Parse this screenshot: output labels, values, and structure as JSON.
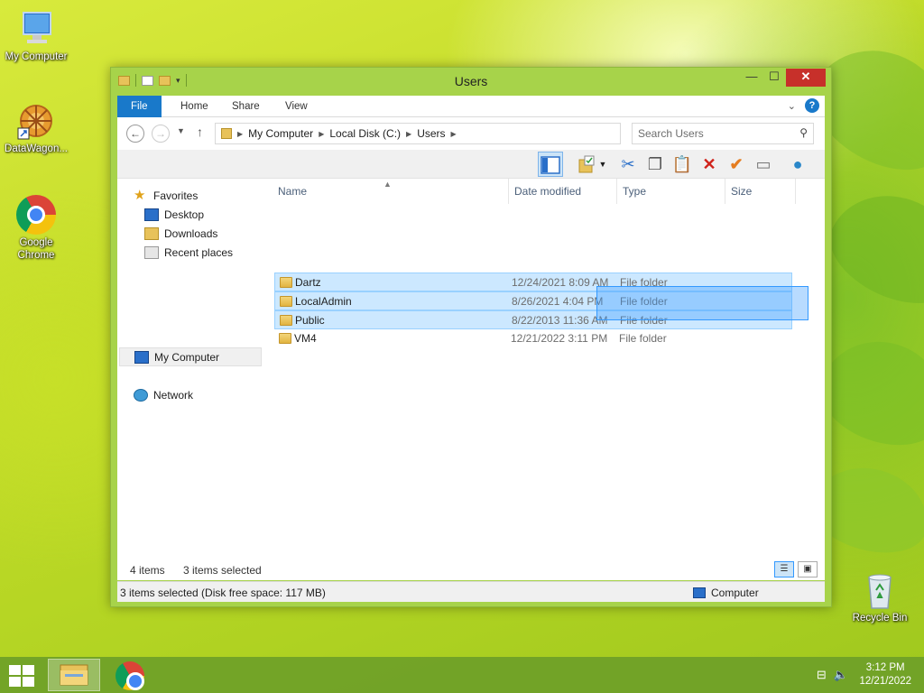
{
  "desktop": {
    "icons": [
      {
        "label": "My Computer"
      },
      {
        "label": "DataWagon..."
      },
      {
        "label": "Google Chrome"
      },
      {
        "label": "Recycle Bin"
      }
    ]
  },
  "window": {
    "title": "Users",
    "controls": {
      "minimize": "—",
      "maximize": "☐",
      "close": "✕"
    }
  },
  "ribbon": {
    "tabs": [
      "File",
      "Home",
      "Share",
      "View"
    ],
    "expand_icon": "⌄",
    "help": "?"
  },
  "address": {
    "breadcrumbs": [
      "My Computer",
      "Local Disk (C:)",
      "Users"
    ],
    "search_placeholder": "Search Users"
  },
  "navpane": {
    "favorites": "Favorites",
    "desktop": "Desktop",
    "downloads": "Downloads",
    "recent": "Recent places",
    "mycomputer": "My Computer",
    "network": "Network"
  },
  "columns": {
    "name": "Name",
    "date": "Date modified",
    "type": "Type",
    "size": "Size"
  },
  "files": [
    {
      "name": "Dartz",
      "date": "12/24/2021 8:09 AM",
      "type": "File folder",
      "size": "",
      "selected": true
    },
    {
      "name": "LocalAdmin",
      "date": "8/26/2021 4:04 PM",
      "type": "File folder",
      "size": "",
      "selected": true
    },
    {
      "name": "Public",
      "date": "8/22/2013 11:36 AM",
      "type": "File folder",
      "size": "",
      "selected": true
    },
    {
      "name": "VM4",
      "date": "12/21/2022 3:11 PM",
      "type": "File folder",
      "size": "",
      "selected": false
    }
  ],
  "info": {
    "items": "4 items",
    "selected": "3 items selected"
  },
  "status": {
    "left": "3 items selected (Disk free space: 117 MB)",
    "right": "Computer"
  },
  "taskbar": {
    "time": "3:12 PM",
    "date": "12/21/2022"
  },
  "colors": {
    "accent": "#1979ca",
    "selection": "#cce8ff",
    "titlebar": "#a7d34a",
    "close": "#c7302a"
  }
}
